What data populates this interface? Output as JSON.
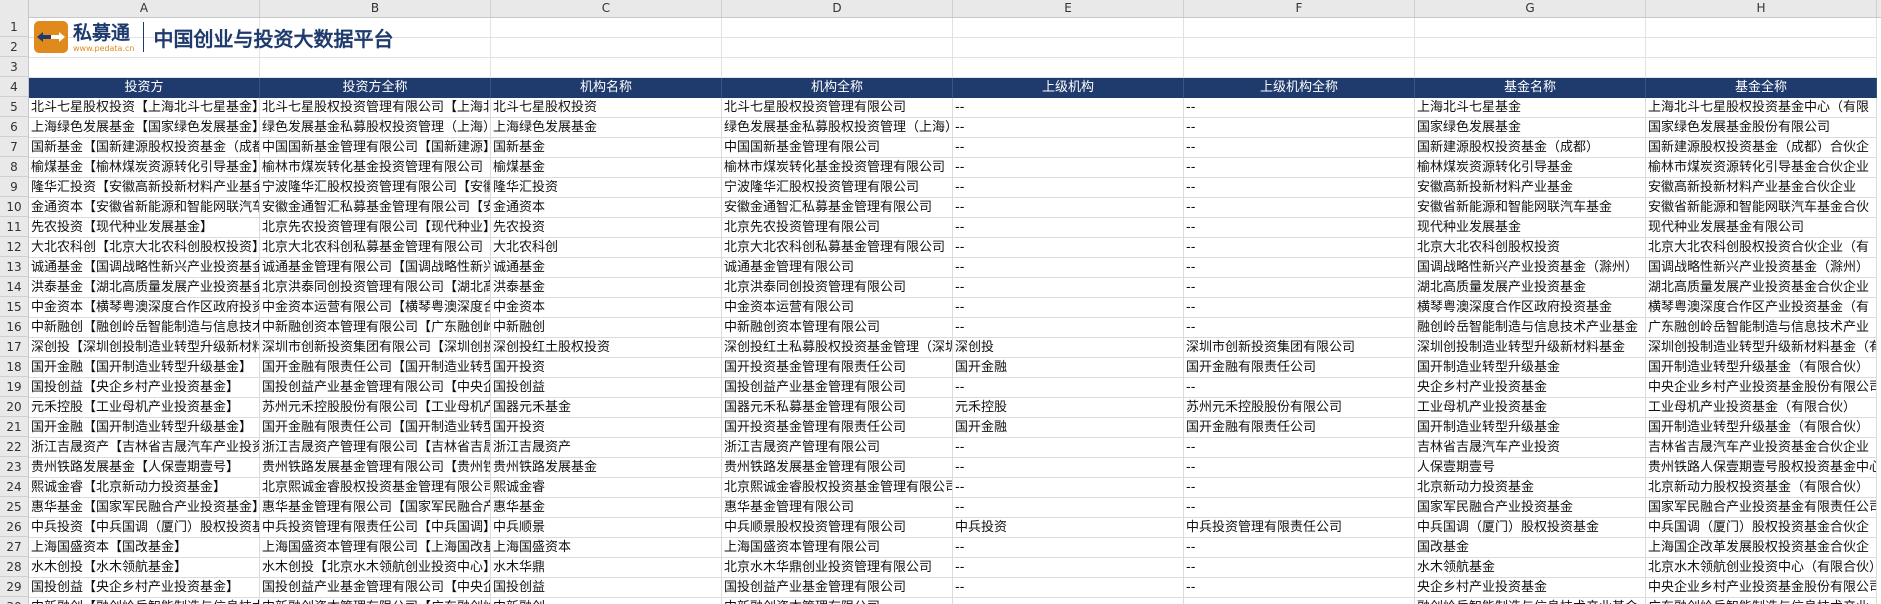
{
  "columns": [
    "A",
    "B",
    "C",
    "D",
    "E",
    "F",
    "G",
    "H"
  ],
  "row_numbers": [
    "1",
    "2",
    "3",
    "4",
    "5",
    "6",
    "7",
    "8",
    "9",
    "10",
    "11",
    "12",
    "13",
    "14",
    "15",
    "16",
    "17",
    "18",
    "19",
    "20",
    "21",
    "22",
    "23",
    "24",
    "25",
    "26",
    "27",
    "28",
    "29",
    "30"
  ],
  "brand": {
    "name": "私募通",
    "url": "www.pedata.cn",
    "title": "中国创业与投资大数据平台"
  },
  "headers": [
    "投资方",
    "投资方全称",
    "机构名称",
    "机构全称",
    "上级机构",
    "上级机构全称",
    "基金名称",
    "基金全称"
  ],
  "rows": [
    [
      "北斗七星股权投资【上海北斗七星基金】",
      "北斗七星股权投资管理有限公司【上海北斗七星基金中心】",
      "北斗七星股权投资",
      "北斗七星股权投资管理有限公司",
      "--",
      "--",
      "上海北斗七星基金",
      "上海北斗七星股权投资基金中心（有限"
    ],
    [
      "上海绿色发展基金【国家绿色发展基金】",
      "绿色发展基金私募股权投资管理（上海）",
      "上海绿色发展基金",
      "绿色发展基金私募股权投资管理（上海）",
      "--",
      "--",
      "国家绿色发展基金",
      "国家绿色发展基金股份有限公司"
    ],
    [
      "国新基金【国新建源股权投资基金（成都）】",
      "中国国新基金管理有限公司【国新建源】",
      "国新基金",
      "中国国新基金管理有限公司",
      "--",
      "--",
      "国新建源股权投资基金（成都）",
      "国新建源股权投资基金（成都）合伙企"
    ],
    [
      "榆煤基金【榆林煤炭资源转化引导基金】",
      "榆林市煤炭转化基金投资管理有限公司",
      "榆煤基金",
      "榆林市煤炭转化基金投资管理有限公司",
      "--",
      "--",
      "榆林煤炭资源转化引导基金",
      "榆林市煤炭资源转化引导基金合伙企业"
    ],
    [
      "隆华汇投资【安徽高新投新材料产业基金】",
      "宁波隆华汇股权投资管理有限公司【安徽】",
      "隆华汇投资",
      "宁波隆华汇股权投资管理有限公司",
      "--",
      "--",
      "安徽高新投新材料产业基金",
      "安徽高新投新材料产业基金合伙企业"
    ],
    [
      "金通资本【安徽省新能源和智能网联汽车基金】",
      "安徽金通智汇私募基金管理有限公司【安徽】",
      "金通资本",
      "安徽金通智汇私募基金管理有限公司",
      "--",
      "--",
      "安徽省新能源和智能网联汽车基金",
      "安徽省新能源和智能网联汽车基金合伙"
    ],
    [
      "先农投资【现代种业发展基金】",
      "北京先农投资管理有限公司【现代种业】",
      "先农投资",
      "北京先农投资管理有限公司",
      "--",
      "--",
      "现代种业发展基金",
      "现代种业发展基金有限公司"
    ],
    [
      "大北农科创【北京大北农科创股权投资】",
      "北京大北农科创私募基金管理有限公司",
      "大北农科创",
      "北京大北农科创私募基金管理有限公司",
      "--",
      "--",
      "北京大北农科创股权投资",
      "北京大北农科创股权投资合伙企业（有"
    ],
    [
      "诚通基金【国调战略性新兴产业投资基金】",
      "诚通基金管理有限公司【国调战略性新兴】",
      "诚通基金",
      "诚通基金管理有限公司",
      "--",
      "--",
      "国调战略性新兴产业投资基金（滁州）",
      "国调战略性新兴产业投资基金（滁州）"
    ],
    [
      "洪泰基金【湖北高质量发展产业投资基金】",
      "北京洪泰同创投资管理有限公司【湖北高】",
      "洪泰基金",
      "北京洪泰同创投资管理有限公司",
      "--",
      "--",
      "湖北高质量发展产业投资基金",
      "湖北高质量发展产业投资基金合伙企业"
    ],
    [
      "中金资本【横琴粤澳深度合作区政府投资基金】",
      "中金资本运营有限公司【横琴粤澳深度合作】",
      "中金资本",
      "中金资本运营有限公司",
      "--",
      "--",
      "横琴粤澳深度合作区政府投资基金",
      "横琴粤澳深度合作区产业投资基金（有"
    ],
    [
      "中新融创【融创岭岳智能制造与信息技术产业基金】",
      "中新融创资本管理有限公司【广东融创岭岳】",
      "中新融创",
      "中新融创资本管理有限公司",
      "--",
      "--",
      "融创岭岳智能制造与信息技术产业基金",
      "广东融创岭岳智能制造与信息技术产业"
    ],
    [
      "深创投【深圳创投制造业转型升级新材料基金】",
      "深圳市创新投资集团有限公司【深圳创投】",
      "深创投红土股权投资",
      "深创投红土私募股权投资基金管理（深圳）",
      "深创投",
      "深圳市创新投资集团有限公司",
      "深圳创投制造业转型升级新材料基金",
      "深圳创投制造业转型升级新材料基金（有"
    ],
    [
      "国开金融【国开制造业转型升级基金】",
      "国开金融有限责任公司【国开制造业转型】",
      "国开投资",
      "国开投资基金管理有限责任公司",
      "国开金融",
      "国开金融有限责任公司",
      "国开制造业转型升级基金",
      "国开制造业转型升级基金（有限合伙）"
    ],
    [
      "国投创益【央企乡村产业投资基金】",
      "国投创益产业基金管理有限公司【中央企业】",
      "国投创益",
      "国投创益产业基金管理有限公司",
      "--",
      "--",
      "央企乡村产业投资基金",
      "中央企业乡村产业投资基金股份有限公司"
    ],
    [
      "元禾控股【工业母机产业投资基金】",
      "苏州元禾控股股份有限公司【工业母机产业】",
      "国器元禾基金",
      "国器元禾私募基金管理有限公司",
      "元禾控股",
      "苏州元禾控股股份有限公司",
      "工业母机产业投资基金",
      "工业母机产业投资基金（有限合伙）"
    ],
    [
      "国开金融【国开制造业转型升级基金】",
      "国开金融有限责任公司【国开制造业转型】",
      "国开投资",
      "国开投资基金管理有限责任公司",
      "国开金融",
      "国开金融有限责任公司",
      "国开制造业转型升级基金",
      "国开制造业转型升级基金（有限合伙）"
    ],
    [
      "浙江吉晟资产【吉林省吉晟汽车产业投资基金】",
      "浙江吉晟资产管理有限公司【吉林省吉晟】",
      "浙江吉晟资产",
      "浙江吉晟资产管理有限公司",
      "--",
      "--",
      "吉林省吉晟汽车产业投资",
      "吉林省吉晟汽车产业投资基金合伙企业"
    ],
    [
      "贵州铁路发展基金【人保壹期壹号】",
      "贵州铁路发展基金管理有限公司【贵州铁路】",
      "贵州铁路发展基金",
      "贵州铁路发展基金管理有限公司",
      "--",
      "--",
      "人保壹期壹号",
      "贵州铁路人保壹期壹号股权投资基金中心"
    ],
    [
      "熙诚金睿【北京新动力投资基金】",
      "北京熙诚金睿股权投资基金管理有限公司",
      "熙诚金睿",
      "北京熙诚金睿股权投资基金管理有限公司",
      "--",
      "--",
      "北京新动力投资基金",
      "北京新动力股权投资基金（有限合伙）"
    ],
    [
      "惠华基金【国家军民融合产业投资基金】",
      "惠华基金管理有限公司【国家军民融合产业】",
      "惠华基金",
      "惠华基金管理有限公司",
      "--",
      "--",
      "国家军民融合产业投资基金",
      "国家军民融合产业投资基金有限责任公司"
    ],
    [
      "中兵投资【中兵国调（厦门）股权投资基金】",
      "中兵投资管理有限责任公司【中兵国调】",
      "中兵顺景",
      "中兵顺景股权投资管理有限公司",
      "中兵投资",
      "中兵投资管理有限责任公司",
      "中兵国调（厦门）股权投资基金",
      "中兵国调（厦门）股权投资基金合伙企"
    ],
    [
      "上海国盛资本【国改基金】",
      "上海国盛资本管理有限公司【上海国改基金】",
      "上海国盛资本",
      "上海国盛资本管理有限公司",
      "--",
      "--",
      "国改基金",
      "上海国企改革发展股权投资基金合伙企"
    ],
    [
      "水木创投【水木领航基金】",
      "水木创投【北京水木领航创业投资中心】",
      "水木华鼎",
      "北京水木华鼎创业投资管理有限公司",
      "--",
      "--",
      "水木领航基金",
      "北京水木领航创业投资中心（有限合伙）"
    ],
    [
      "国投创益【央企乡村产业投资基金】",
      "国投创益产业基金管理有限公司【中央企业】",
      "国投创益",
      "国投创益产业基金管理有限公司",
      "--",
      "--",
      "央企乡村产业投资基金",
      "中央企业乡村产业投资基金股份有限公司"
    ],
    [
      "中新融创【融创岭岳智能制造与信息技术产业基金】",
      "中新融创资本管理有限公司【广东融创岭岳】",
      "中新融创",
      "中新融创资本管理有限公司",
      "--",
      "--",
      "融创岭岳智能制造与信息技术产业基金",
      "广东融创岭岳智能制造与信息技术产业"
    ]
  ]
}
